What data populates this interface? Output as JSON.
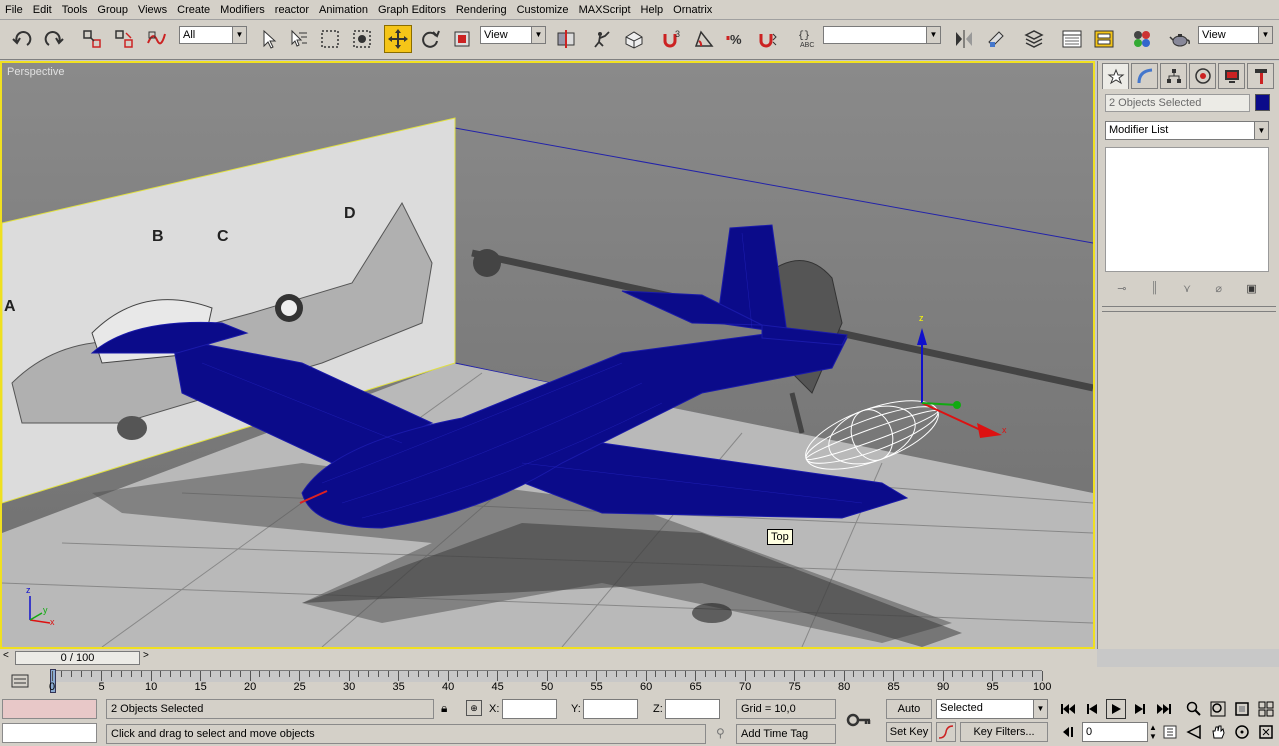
{
  "menu": [
    "File",
    "Edit",
    "Tools",
    "Group",
    "Views",
    "Create",
    "Modifiers",
    "reactor",
    "Animation",
    "Graph Editors",
    "Rendering",
    "Customize",
    "MAXScript",
    "Help",
    "Ornatrix"
  ],
  "toolbar": {
    "filter_value": "All",
    "refcoord_value": "View",
    "named_sel_value": "",
    "viewport_view_value": "View"
  },
  "viewport": {
    "label": "Perspective",
    "tooltip": "Top",
    "axis_x": "x",
    "axis_y": "y",
    "axis_z": "z",
    "gizmo_x": "x",
    "gizmo_z": "z",
    "sketch_labels": [
      "A",
      "B",
      "C",
      "D"
    ]
  },
  "command_panel": {
    "name_value": "2 Objects Selected",
    "object_color": "#0b0b8a",
    "modifier_list": "Modifier List"
  },
  "timeline": {
    "slider_text": "0 / 100",
    "ticks": [
      "0",
      "5",
      "10",
      "15",
      "20",
      "25",
      "30",
      "35",
      "40",
      "45",
      "50",
      "55",
      "60",
      "65",
      "70",
      "75",
      "80",
      "85",
      "90",
      "95",
      "100"
    ]
  },
  "status": {
    "selection_text": "2 Objects Selected",
    "prompt_text": "Click and drag to select and move objects",
    "x_label": "X:",
    "y_label": "Y:",
    "z_label": "Z:",
    "x_value": "",
    "y_value": "",
    "z_value": "",
    "grid_text": "Grid = 10,0",
    "add_time_tag": "Add Time Tag",
    "auto_key": "Auto Key",
    "set_key": "Set Key",
    "key_mode_value": "Selected",
    "key_filters": "Key Filters...",
    "current_frame": "0"
  },
  "colors": {
    "plane_blue": "#0b0b8a",
    "viewport_border": "#f0e020",
    "active_tool": "#f5c518"
  }
}
